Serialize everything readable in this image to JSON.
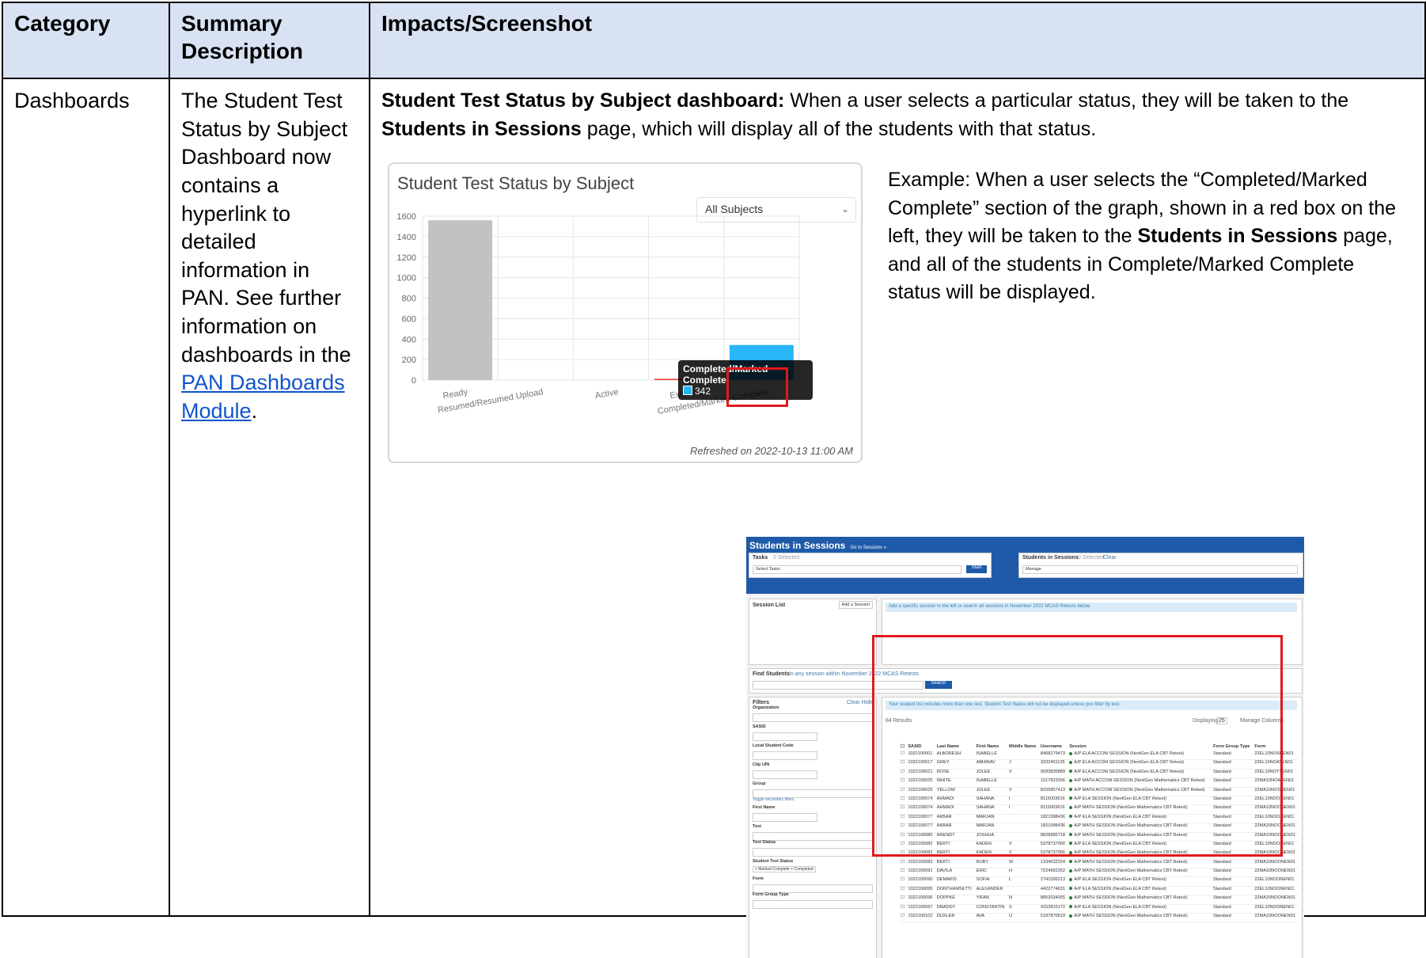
{
  "headers": {
    "category": "Category",
    "summary": "Summary Description",
    "impacts": "Impacts/Screenshot"
  },
  "row": {
    "category": "Dashboards",
    "summary_text": "The Student Test Status by Subject Dashboard now contains a hyperlink to detailed information in PAN. See further information on dashboards in the",
    "summary_link": "PAN Dashboards Module",
    "summary_end": ".",
    "impact_bold1": "Student Test Status by Subject dashboard:",
    "impact_text1": " When a user selects a particular status, they will be taken to the ",
    "impact_bold2": "Students in Sessions",
    "impact_text2": " page, which will display all of the students with that status.",
    "example_text1": "Example: When a user selects the “Completed/Marked Complete” section of the graph, shown in a red box on the left, they will be taken to the ",
    "example_bold": "Students in Sessions",
    "example_text2": " page, and all of the students in Complete/Marked Complete status will be displayed."
  },
  "chart_data": {
    "type": "bar",
    "title": "Student Test Status by Subject",
    "select_value": "All Subjects",
    "categories": [
      "Ready",
      "Resumed/Resumed Upload",
      "Active",
      "Exited",
      "Completed/Marked Complete"
    ],
    "values": [
      1560,
      0,
      0,
      10,
      342
    ],
    "colors": [
      "#c2c2c2",
      "#c2c2c2",
      "#c2c2c2",
      "#e53935",
      "#29b6f6"
    ],
    "ylim": [
      0,
      1600
    ],
    "yticks": [
      0,
      200,
      400,
      600,
      800,
      1000,
      1200,
      1400,
      1600
    ],
    "grid": true,
    "tooltip": {
      "title": "Completed/Marked Complete",
      "value": "342"
    },
    "refreshed": "Refreshed on 2022-10-13 11:00 AM"
  },
  "sis": {
    "title": "Students in Sessions",
    "go_link": "Go to Sessions »",
    "tasks_label": "Tasks",
    "tasks_selected": "0 Selected",
    "select_tasks": "Select Tasks",
    "start_btn": "Start",
    "sis_label": "Students in Sessions",
    "sis_selected": "0 Selected",
    "clear": "Clear",
    "manage": "Manage",
    "session_list": "Session List",
    "add_session": "Add a Session",
    "session_info": "Add a specific session to the left or search all sessions in November 2022 MCAS Retests below.",
    "find_students": "Find Students",
    "find_scope": "In any session within November 2022 MCAS Retests",
    "search_btn": "Search",
    "filters": "Filters",
    "clear_hide": "Clear  Hide",
    "filter_labels": [
      "Organization",
      "SASID",
      "Local Student Code",
      "Clip UIN",
      "Group",
      "First Name",
      "Test",
      "Test Status",
      "Student Test Status",
      "Form",
      "Form Group Type"
    ],
    "toggle_filters": "Toggle secondary filters",
    "status_chips": "× Marked Complete   × Completed",
    "list_info": "Your student list includes more than one test. Student Test Status will not be displayed unless you filter by test.",
    "results": "84 Results",
    "displaying": "Displaying",
    "display_count": "25",
    "manage_columns": "Manage Columns",
    "columns": [
      "SASID",
      "Last Name",
      "First Name",
      "Middle Name",
      "Username",
      "Session",
      "Form Group Type",
      "Form"
    ],
    "rows": [
      [
        "1022100001",
        "ALBORESH",
        "ISABELLE",
        "",
        "8468279473",
        "A/P ELA ACCOM SESSION (NextGen ELA CBT Retest)",
        "Standard",
        "22EL10NOSREN01"
      ],
      [
        "1022100017",
        "GREY",
        "ABHINAV",
        "J",
        "3332451135",
        "A/P ELA ACCOM SESSION (NextGen ELA CBT Retest)",
        "Standard",
        "22EL10NOATEN01"
      ],
      [
        "1022100021",
        "ROSE",
        "JOLEE",
        "V",
        "9093830889",
        "A/P ELA ACCOM SESSION (NextGen ELA CBT Retest)",
        "Standard",
        "22EL10NOTSEN01"
      ],
      [
        "1022100025",
        "WHITE",
        "ISABELLE",
        "",
        "1517823266",
        "A/P MATH ACCOM SESSION (NextGen Mathematics CBT Retest)",
        "Standard",
        "22MA10NOATEN01"
      ],
      [
        "1022100029",
        "YELLOW",
        "JOLEE",
        "V",
        "8155857413",
        "A/P MATH ACCOM SESSION (NextGen Mathematics CBT Retest)",
        "Standard",
        "22MA10NOSREN01"
      ],
      [
        "1022100074",
        "AHMADI",
        "SAHANA",
        "I",
        "8115003616",
        "A/P ELA SESSION (NextGen ELA CBT Retest)",
        "Standard",
        "22EL10NOONEN01"
      ],
      [
        "1022100074",
        "AHMADI",
        "SAHANA",
        "I",
        "8115003616",
        "A/P MATH SESSION (NextGen Mathematics CBT Retest)",
        "Standard",
        "22MA10NOONEN01"
      ],
      [
        "1022100077",
        "AKBAR",
        "MARJAN",
        "",
        "1821998436",
        "A/P ELA SESSION (NextGen ELA CBT Retest)",
        "Standard",
        "22EL10NOONEN01"
      ],
      [
        "1022100077",
        "AKBAR",
        "MARJAN",
        "",
        "1821998436",
        "A/P MATH SESSION (NextGen Mathematics CBT Retest)",
        "Standard",
        "22MA10NOONEN01"
      ],
      [
        "1022100080",
        "ARENDT",
        "JOSHUA",
        "",
        "8828985718",
        "A/P MATH SESSION (NextGen Mathematics CBT Retest)",
        "Standard",
        "22MA10NOONEN01"
      ],
      [
        "1022100082",
        "BERTI",
        "KADEN",
        "V",
        "5378737066",
        "A/P ELA SESSION (NextGen ELA CBT Retest)",
        "Standard",
        "22EL10NOONEN01"
      ],
      [
        "1022100082",
        "BERTI",
        "KADEN",
        "V",
        "5378737066",
        "A/P MATH SESSION (NextGen Mathematics CBT Retest)",
        "Standard",
        "22MA10NOONEN01"
      ],
      [
        "1022100083",
        "BERTI",
        "RUBY",
        "W",
        "1334632324",
        "A/P MATH SESSION (NextGen Mathematics CBT Retest)",
        "Standard",
        "22MA10NOONEN01"
      ],
      [
        "1022100091",
        "DAVILA",
        "ERIC",
        "H",
        "7224992262",
        "A/P MATH SESSION (NextGen Mathematics CBT Retest)",
        "Standard",
        "22MA10NOONEN01"
      ],
      [
        "1022100090",
        "DEMAKIS",
        "SOFIA",
        "L",
        "2741595213",
        "A/P ELA SESSION (NextGen ELA CBT Retest)",
        "Standard",
        "22EL10NOONEN01"
      ],
      [
        "1022100095",
        "DONTHAMSETTI",
        "ALEXANDER",
        "",
        "4422774631",
        "A/P ELA SESSION (NextGen ELA CBT Retest)",
        "Standard",
        "22EL10NOONEN01"
      ],
      [
        "1022100096",
        "DOPPKE",
        "YIFAN",
        "N",
        "8852034055",
        "A/P MATH SESSION (NextGen Mathematics CBT Retest)",
        "Standard",
        "22MA10NOONEN01"
      ],
      [
        "1022100097",
        "DRADDY",
        "CONSTANTIN",
        "X",
        "4152815172",
        "A/P ELA SESSION (NextGen ELA CBT Retest)",
        "Standard",
        "22EL10NOONEN01"
      ],
      [
        "1022100102",
        "DUXLER",
        "AVA",
        "U",
        "5187870619",
        "A/P MATH SESSION (NextGen Mathematics CBT Retest)",
        "Standard",
        "22MA10NOONEN01"
      ]
    ]
  }
}
